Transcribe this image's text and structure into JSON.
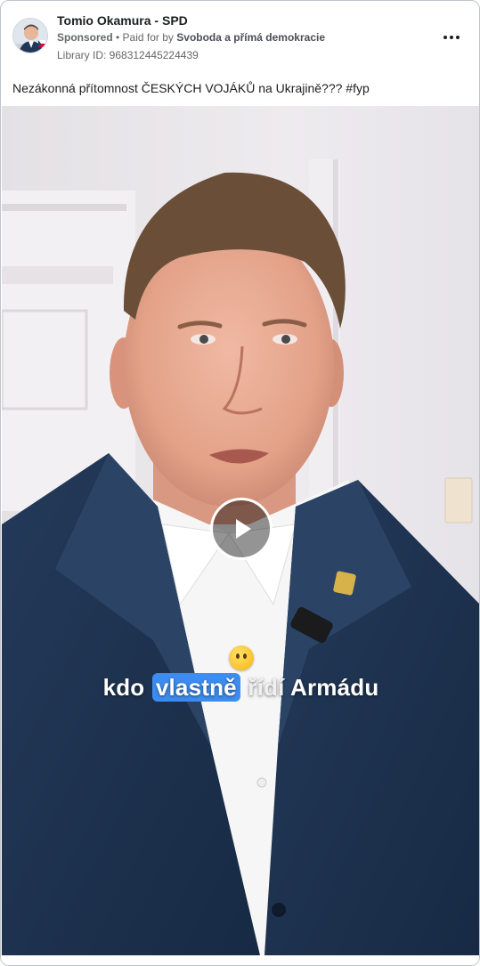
{
  "ad": {
    "page_name": "Tomio Okamura - SPD",
    "sponsored_label": "Sponsored",
    "paid_for_prefix": "• Paid for by",
    "payer": "Svoboda a přímá demokracie",
    "library_id": "Library ID: 968312445224439",
    "more_icon": "more-horizontal-icon",
    "text": "Nezákonná přítomnost ČESKÝCH VOJÁKŮ na Ukrajině??? #fyp"
  },
  "video": {
    "play_icon": "play-icon",
    "caption": {
      "word1": "kdo",
      "word2": "vlastně",
      "word3": "řídí",
      "word4": "Armádu",
      "emoji": "thinking-face-emoji",
      "highlight_color": "#3d8df0"
    },
    "pin_badge": "SPD"
  },
  "colors": {
    "jacket": "#1f3350",
    "wall": "#ebe8ec",
    "text_secondary": "#65676b"
  }
}
